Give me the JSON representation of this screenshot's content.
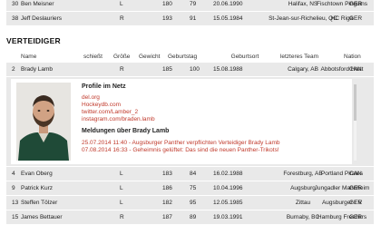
{
  "rows_top": [
    {
      "num": "30",
      "name": "Ben Meisner",
      "shoots": "L",
      "height": "180",
      "weight": "79",
      "dob": "20.06.1990",
      "birthplace": "Halifax, NS",
      "last_team": "Fischtown Pinguins",
      "nation": "GER"
    },
    {
      "num": "38",
      "name": "Jeff Deslauriers",
      "shoots": "R",
      "height": "193",
      "weight": "91",
      "dob": "15.05.1984",
      "birthplace": "St-Jean-sur-Richelieu, QC",
      "last_team": "HC Riga",
      "nation": "GER"
    }
  ],
  "section_title": "VERTEIDIGER",
  "headers": {
    "name": "Name",
    "shoots": "schießt",
    "height": "Größe",
    "weight": "Gewicht",
    "dob": "Geburtstag",
    "birthplace": "Geburtsort",
    "last_team": "letzteres Team",
    "nation": "Nation"
  },
  "featured_row": {
    "num": "2",
    "name": "Brady Lamb",
    "shoots": "R",
    "height": "185",
    "weight": "100",
    "dob": "15.08.1988",
    "birthplace": "Calgary, AB",
    "last_team": "Abbotsford Heat",
    "nation": "CAN"
  },
  "profile": {
    "title": "Profile im Netz",
    "links": [
      "del.org",
      "Hockeydb.com",
      "twitter.com/Lamber_2",
      "instagram.com/braden.lamb"
    ],
    "news_title": "Meldungen über Brady Lamb",
    "news": [
      "25.07.2014 11:40 - Augsburger Panther verpflichten Verteidiger Brady Lamb",
      "07.08.2014 16:33 - Geheimnis gelüftet: Das sind die neuen Panther-Trikots!"
    ]
  },
  "rows_bottom": [
    {
      "num": "4",
      "name": "Evan Oberg",
      "shoots": "L",
      "height": "183",
      "weight": "84",
      "dob": "16.02.1988",
      "birthplace": "Forestburg, AB",
      "last_team": "Portland Pirates",
      "nation": "CAN"
    },
    {
      "num": "9",
      "name": "Patrick Kurz",
      "shoots": "L",
      "height": "186",
      "weight": "75",
      "dob": "10.04.1996",
      "birthplace": "Augsburg",
      "last_team": "Jungadler Mannheim",
      "nation": "GER"
    },
    {
      "num": "13",
      "name": "Steffen Tölzer",
      "shoots": "L",
      "height": "182",
      "weight": "95",
      "dob": "12.05.1985",
      "birthplace": "Zittau",
      "last_team": "Augsburger EV",
      "nation": "GER"
    },
    {
      "num": "15",
      "name": "James Bettauer",
      "shoots": "R",
      "height": "187",
      "weight": "89",
      "dob": "19.03.1991",
      "birthplace": "Burnaby, BC",
      "last_team": "Hamburg Freezers",
      "nation": "GER"
    }
  ],
  "colors": {
    "row_bg": "#e9e9e9",
    "link": "#c0392b",
    "text": "#222222"
  }
}
